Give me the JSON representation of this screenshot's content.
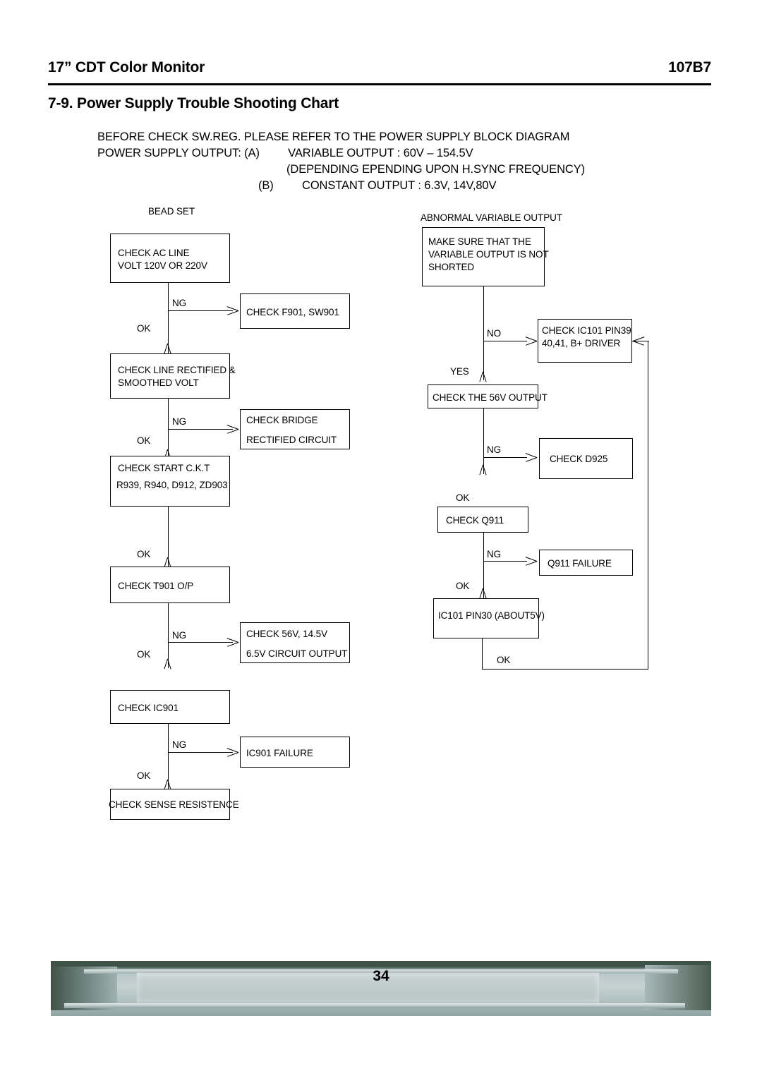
{
  "header": {
    "title": "17” CDT Color Monitor",
    "model": "107B7"
  },
  "section": {
    "title": "7-9. Power Supply Trouble Shooting Chart"
  },
  "intro": {
    "line1": "BEFORE CHECK SW.REG. PLEASE REFER TO THE POWER SUPPLY BLOCK DIAGRAM",
    "line2_label": "POWER SUPPLY OUTPUT:",
    "line2_tag": "(A)",
    "line2_text": "VARIABLE OUTPUT : 60V – 154.5V",
    "line3_text": "(DEPENDING EPENDING UPON H.SYNC FREQUENCY)",
    "line4_tag": "(B)",
    "line4_text": "CONSTANT OUTPUT : 6.3V, 14V,80V"
  },
  "flow_left": {
    "caption": "BEAD SET",
    "boxes": {
      "ac_line_l1": "CHECK AC LINE",
      "ac_line_l2": "VOLT 120V OR 220V",
      "f901": "CHECK F901, SW901",
      "line_rect_l1": "CHECK  LINE  RECTIFIED  &",
      "line_rect_l2": "SMOOTHED VOLT",
      "bridge_l1": "CHECK BRIDGE",
      "bridge_l2": "RECTIFIED CIRCUIT",
      "start_ckt_l1": "CHECK START C.K.T",
      "start_ckt_l2": "R939, R940, D912, ZD903",
      "t901": "CHECK T901 O/P",
      "volt_out_l1": "CHECK 56V, 14.5V",
      "volt_out_l2": "6.5V CIRCUIT OUTPUT",
      "ic901": "CHECK IC901",
      "ic901_fail": "IC901 FAILURE",
      "sense_res": "CHECK SENSE RESISTENCE"
    },
    "labels": {
      "ng1": "NG",
      "ok1": "OK",
      "ng2": "NG",
      "ok2": "OK",
      "ok3": "OK",
      "ng4": "NG",
      "ok4": "OK",
      "ng5": "NG",
      "ok5": "OK"
    }
  },
  "flow_right": {
    "caption": "ABNORMAL VARIABLE OUTPUT",
    "boxes": {
      "make_sure_l1": "MAKE   SURE   THAT   THE",
      "make_sure_l2": "VARIABLE  OUTPUT  IS  NOT",
      "make_sure_l3": "SHORTED",
      "ic101_l1": "CHECK     IC101     PIN39",
      "ic101_l2": "40,41, B+ DRIVER",
      "check_56v": "CHECK THE 56V OUTPUT",
      "d925": "CHECK D925",
      "q911": "CHECK Q911",
      "q911_fail": "Q911 FAILURE",
      "ic101_pin30": "IC101 PIN30 (ABOUT5V)"
    },
    "labels": {
      "no1": "NO",
      "yes1": "YES",
      "ng2": "NG",
      "ok2": "OK",
      "ng3": "NG",
      "ok3": "OK",
      "ok4": "OK"
    }
  },
  "footer": {
    "page_number": "34"
  }
}
